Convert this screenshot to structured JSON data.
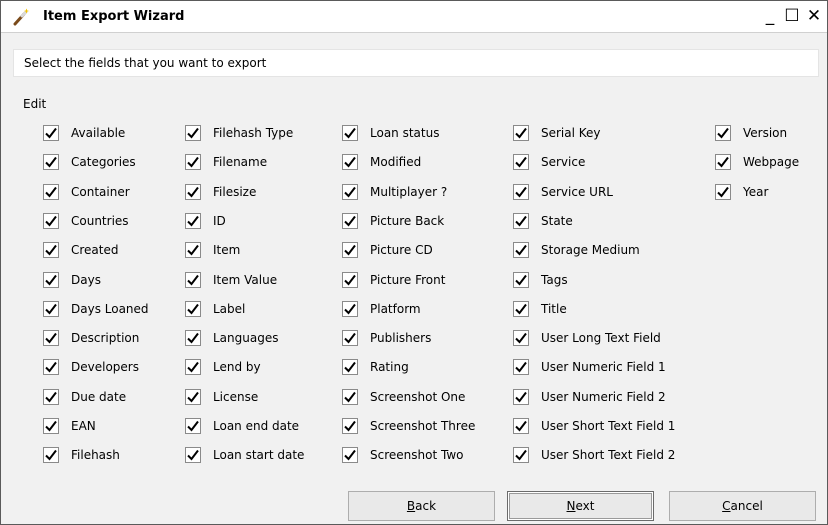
{
  "window": {
    "title": "Item Export Wizard",
    "controls": {
      "minimize": "_",
      "maximize": "☐",
      "close": "✕"
    }
  },
  "instruction": "Select the fields that you want to export",
  "group": {
    "label": "Edit"
  },
  "fields": [
    [
      {
        "label": "Available",
        "checked": true
      },
      {
        "label": "Categories",
        "checked": true
      },
      {
        "label": "Container",
        "checked": true
      },
      {
        "label": "Countries",
        "checked": true
      },
      {
        "label": "Created",
        "checked": true
      },
      {
        "label": "Days",
        "checked": true
      },
      {
        "label": "Days Loaned",
        "checked": true
      },
      {
        "label": "Description",
        "checked": true
      },
      {
        "label": "Developers",
        "checked": true
      },
      {
        "label": "Due date",
        "checked": true
      },
      {
        "label": "EAN",
        "checked": true
      },
      {
        "label": "Filehash",
        "checked": true
      }
    ],
    [
      {
        "label": "Filehash Type",
        "checked": true
      },
      {
        "label": "Filename",
        "checked": true
      },
      {
        "label": "Filesize",
        "checked": true
      },
      {
        "label": "ID",
        "checked": true
      },
      {
        "label": "Item",
        "checked": true
      },
      {
        "label": "Item Value",
        "checked": true
      },
      {
        "label": "Label",
        "checked": true
      },
      {
        "label": "Languages",
        "checked": true
      },
      {
        "label": "Lend by",
        "checked": true
      },
      {
        "label": "License",
        "checked": true
      },
      {
        "label": "Loan end date",
        "checked": true
      },
      {
        "label": "Loan start date",
        "checked": true
      }
    ],
    [
      {
        "label": "Loan status",
        "checked": true
      },
      {
        "label": "Modified",
        "checked": true
      },
      {
        "label": "Multiplayer ?",
        "checked": true
      },
      {
        "label": "Picture Back",
        "checked": true
      },
      {
        "label": "Picture CD",
        "checked": true
      },
      {
        "label": "Picture Front",
        "checked": true
      },
      {
        "label": "Platform",
        "checked": true
      },
      {
        "label": "Publishers",
        "checked": true
      },
      {
        "label": "Rating",
        "checked": true
      },
      {
        "label": "Screenshot One",
        "checked": true
      },
      {
        "label": "Screenshot Three",
        "checked": true
      },
      {
        "label": "Screenshot Two",
        "checked": true
      }
    ],
    [
      {
        "label": "Serial Key",
        "checked": true
      },
      {
        "label": "Service",
        "checked": true
      },
      {
        "label": "Service URL",
        "checked": true
      },
      {
        "label": "State",
        "checked": true
      },
      {
        "label": "Storage Medium",
        "checked": true
      },
      {
        "label": "Tags",
        "checked": true
      },
      {
        "label": "Title",
        "checked": true
      },
      {
        "label": "User Long Text Field",
        "checked": true
      },
      {
        "label": "User Numeric Field 1",
        "checked": true
      },
      {
        "label": "User Numeric Field 2",
        "checked": true
      },
      {
        "label": "User Short Text Field 1",
        "checked": true
      },
      {
        "label": "User Short Text Field 2",
        "checked": true
      }
    ],
    [
      {
        "label": "Version",
        "checked": true
      },
      {
        "label": "Webpage",
        "checked": true
      },
      {
        "label": "Year",
        "checked": true
      }
    ]
  ],
  "buttons": {
    "back": {
      "mnemonic": "B",
      "rest": "ack"
    },
    "next": {
      "mnemonic": "N",
      "rest": "ext"
    },
    "cancel": {
      "mnemonic": "C",
      "rest": "ancel"
    }
  },
  "colors": {
    "title_bar": "#ffffff",
    "dialog_background": "#f1f1f1",
    "button_background": "#e9e9e9"
  },
  "icons": {
    "title": "magic-wand-icon",
    "checkbox_mark": "checkmark-icon"
  }
}
